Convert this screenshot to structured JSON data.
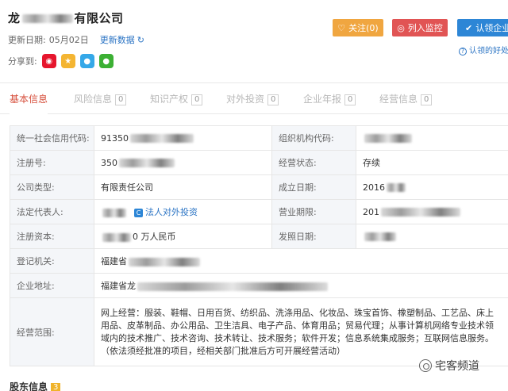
{
  "company": {
    "name_prefix": "龙",
    "name_suffix": "有限公司",
    "update_label": "更新日期:",
    "update_date": "05月02日",
    "refresh_label": "更新数据"
  },
  "share": {
    "label": "分享到:"
  },
  "actions": {
    "follow_label": "关注(0)",
    "monitor_label": "列入监控",
    "claim_label": "认领企业",
    "claim_help": "认领的好处"
  },
  "tabs": [
    {
      "label": "基本信息",
      "count": ""
    },
    {
      "label": "风险信息",
      "count": "0"
    },
    {
      "label": "知识产权",
      "count": "0"
    },
    {
      "label": "对外投资",
      "count": "0"
    },
    {
      "label": "企业年报",
      "count": "0"
    },
    {
      "label": "经营信息",
      "count": "0"
    }
  ],
  "basic_info": {
    "credit_code_label": "统一社会信用代码:",
    "credit_code_value": "91350",
    "org_code_label": "组织机构代码:",
    "reg_no_label": "注册号:",
    "reg_no_value": "350",
    "status_label": "经营状态:",
    "status_value": "存续",
    "type_label": "公司类型:",
    "type_value": "有限责任公司",
    "established_label": "成立日期:",
    "established_value": "2016",
    "legal_rep_label": "法定代表人:",
    "legal_rep_link": "法人对外投资",
    "term_label": "营业期限:",
    "term_value": "201",
    "capital_label": "注册资本:",
    "capital_value": "0 万人民币",
    "license_date_label": "发照日期:",
    "authority_label": "登记机关:",
    "authority_value": "福建省",
    "address_label": "企业地址:",
    "address_value": "福建省龙",
    "scope_label": "经营范围:",
    "scope_value": "网上经营：服装、鞋帽、日用百货、纺织品、洗涤用品、化妆品、珠宝首饰、橡塑制品、工艺品、床上用品、皮革制品、办公用品、卫生洁具、电子产品、体育用品；贸易代理；从事计算机网络专业技术领域内的技术推广、技术咨询、技术转让、技术服务；软件开发；信息系统集成服务；互联网信息服务。（依法须经批准的项目，经相关部门批准后方可开展经营活动）"
  },
  "shareholders": {
    "label": "股东信息",
    "count": "3"
  },
  "watermark": {
    "text": "宅客频道"
  }
}
